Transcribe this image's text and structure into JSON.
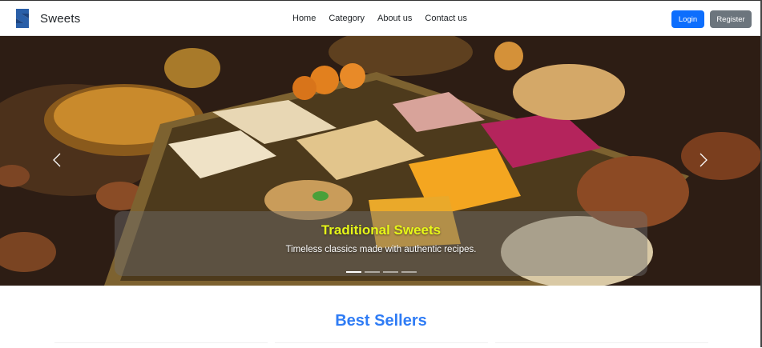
{
  "navbar": {
    "brand_name": "Sweets",
    "links": [
      "Home",
      "Category",
      "About us",
      "Contact us"
    ],
    "login_label": "Login",
    "register_label": "Register"
  },
  "carousel": {
    "caption_title": "Traditional Sweets",
    "caption_text": "Timeless classics made with authentic recipes.",
    "slide_count": 4,
    "active_slide": 1
  },
  "section": {
    "title": "Best Sellers"
  },
  "colors": {
    "primary": "#0d6efd",
    "secondary": "#6c757d",
    "caption_title": "#e7f718",
    "section_title": "#2f7cf5"
  }
}
